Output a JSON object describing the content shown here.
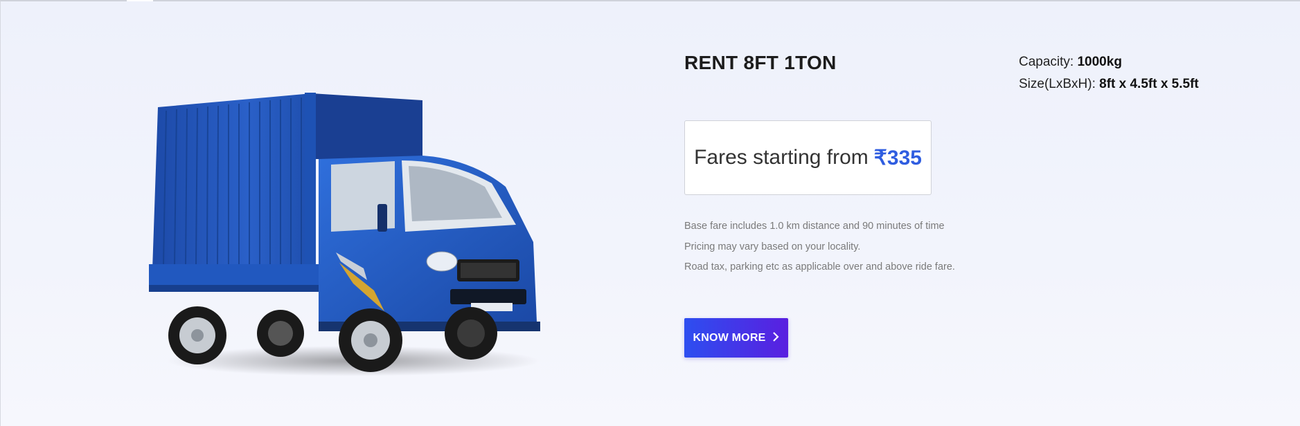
{
  "vehicle": {
    "title": "RENT 8FT 1TON",
    "capacity_label": "Capacity:",
    "capacity_value": "1000kg",
    "size_label": "Size(LxBxH):",
    "size_value": "8ft x 4.5ft x 5.5ft"
  },
  "fare": {
    "prefix": "Fares starting from",
    "price": "₹335"
  },
  "notes": [
    "Base fare includes 1.0 km distance and 90 minutes of time",
    "Pricing may vary based on your locality.",
    "Road tax, parking etc as applicable over and above ride fare."
  ],
  "cta": {
    "label": "KNOW MORE",
    "icon": "chevron-right-icon"
  },
  "colors": {
    "accent_price": "#2f5de0",
    "button_start": "#2d4ef0",
    "button_end": "#5a1fe0",
    "truck_blue": "#2456b8"
  }
}
